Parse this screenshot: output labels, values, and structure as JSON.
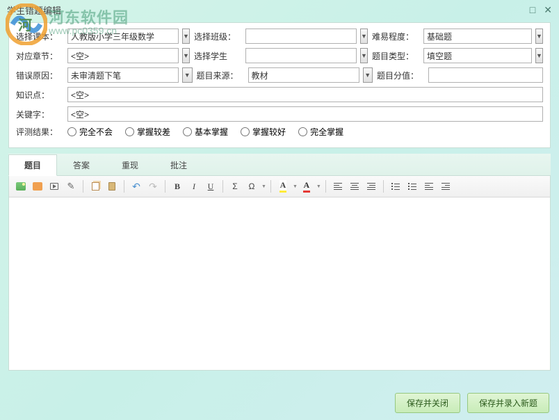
{
  "watermark": {
    "text": "河东软件园",
    "url": "www.pc0359.cn"
  },
  "window": {
    "title": "学生错题编辑"
  },
  "labels": {
    "textbook": "选择课本：",
    "class": "选择班级：",
    "difficulty": "难易程度：",
    "chapter": "对应章节：",
    "student": "选择学生",
    "qtype": "题目类型：",
    "reason": "错误原因：",
    "source": "题目来源：",
    "score": "题目分值：",
    "knowledge": "知识点：",
    "keyword": "关键字：",
    "result": "评测结果："
  },
  "values": {
    "textbook": "人教版小学三年级数学",
    "class": "",
    "difficulty": "基础题",
    "chapter": "<空>",
    "student": "",
    "qtype": "填空题",
    "reason": "未审清题下笔",
    "source": "教材",
    "score": "",
    "knowledge": "<空>",
    "keyword": "<空>"
  },
  "radios": {
    "r1": "完全不会",
    "r2": "掌握较差",
    "r3": "基本掌握",
    "r4": "掌握较好",
    "r5": "完全掌握"
  },
  "tabs": {
    "t1": "题目",
    "t2": "答案",
    "t3": "重现",
    "t4": "批注"
  },
  "toolbar": {
    "bold": "B",
    "italic": "I",
    "underline": "U",
    "sigma": "Σ",
    "omega": "Ω",
    "bgcolor": "A",
    "fgcolor": "A"
  },
  "buttons": {
    "saveClose": "保存并关闭",
    "saveNew": "保存并录入新题"
  }
}
